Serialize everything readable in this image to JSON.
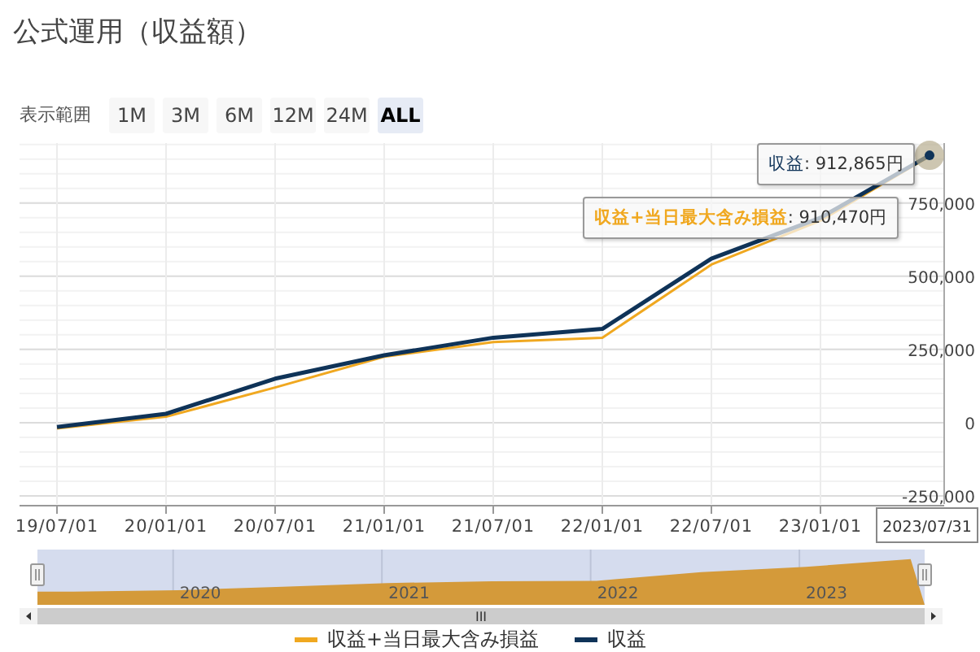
{
  "title": "公式運用（収益額）",
  "range_selector": {
    "label": "表示範囲",
    "buttons": [
      {
        "label": "1M",
        "selected": false
      },
      {
        "label": "3M",
        "selected": false
      },
      {
        "label": "6M",
        "selected": false
      },
      {
        "label": "12M",
        "selected": false
      },
      {
        "label": "24M",
        "selected": false
      },
      {
        "label": "ALL",
        "selected": true
      }
    ]
  },
  "chart": {
    "chart_data": {
      "type": "line",
      "categories": [
        "19/07/01",
        "20/01/01",
        "20/07/01",
        "21/01/01",
        "21/07/01",
        "22/01/01",
        "22/07/01",
        "23/01/01",
        "2023/07/31"
      ],
      "series": [
        {
          "name": "収益+当日最大含み損益",
          "color": "#f0a820",
          "values": [
            -20000,
            20000,
            120000,
            225000,
            275000,
            290000,
            540000,
            690000,
            910000
          ]
        },
        {
          "name": "収益",
          "color": "#0f3358",
          "values": [
            -15000,
            30000,
            150000,
            230000,
            290000,
            320000,
            560000,
            700000,
            913000
          ]
        }
      ],
      "grid": true,
      "ylim": [
        -278000,
        955000
      ],
      "yticks": [
        {
          "value": -250000,
          "label": "-250,000"
        },
        {
          "value": 0,
          "label": "0"
        },
        {
          "value": 250000,
          "label": "250,000"
        },
        {
          "value": 500000,
          "label": "500,000"
        },
        {
          "value": 750000,
          "label": "750,000"
        }
      ]
    },
    "tooltips": [
      {
        "series": "収益",
        "value": ": 912,865円"
      },
      {
        "series": "収益+当日最大含み損益",
        "value": ": 910,470円"
      }
    ]
  },
  "navigator": {
    "year_labels": [
      "2020",
      "2021",
      "2022",
      "2023"
    ],
    "scrollbar_grip": "III"
  }
}
